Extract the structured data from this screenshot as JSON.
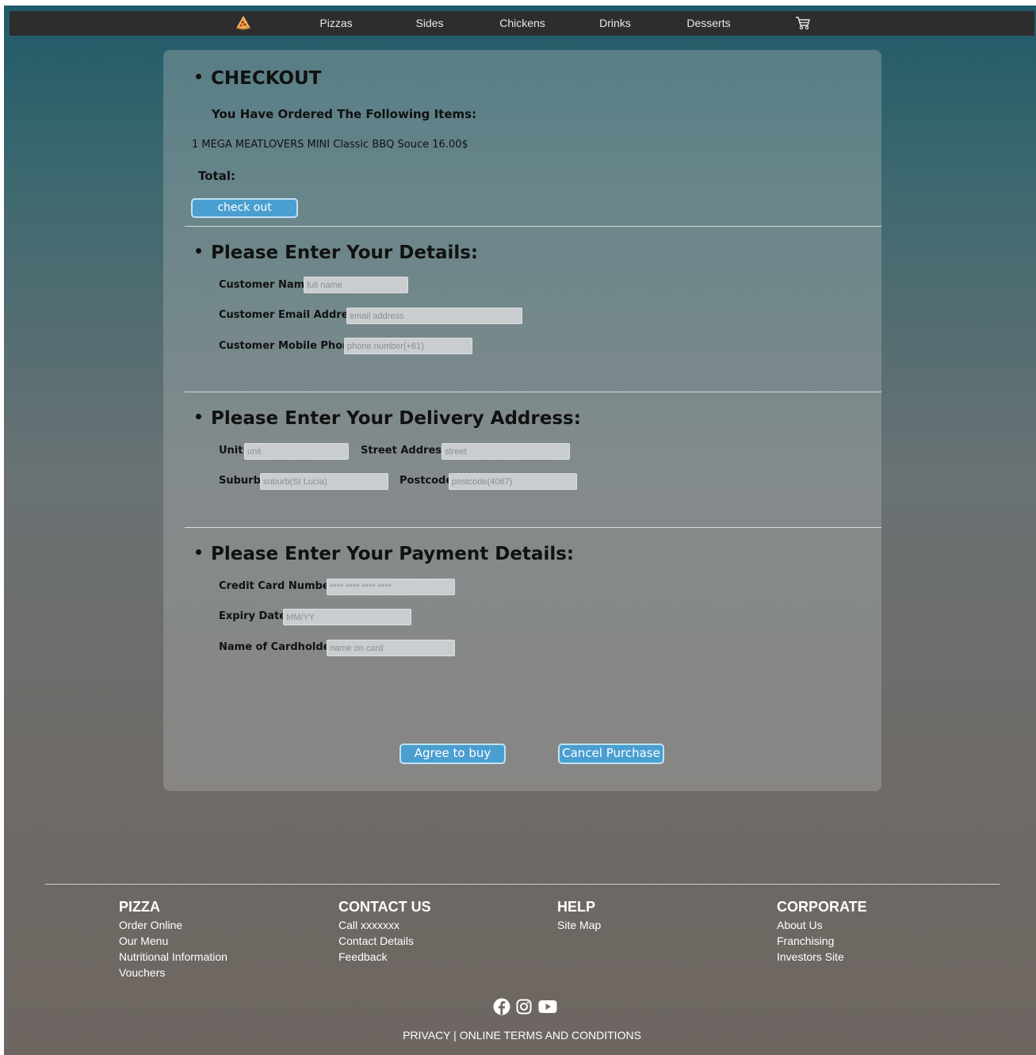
{
  "nav": {
    "items": [
      "Pizzas",
      "Sides",
      "Chickens",
      "Drinks",
      "Desserts"
    ]
  },
  "checkout": {
    "title": "CHECKOUT",
    "ordered_heading": "You Have Ordered The Following Items:",
    "order_line": "1 MEGA MEATLOVERS MINI Classic BBQ Souce 16.00$",
    "total_label": "Total:",
    "checkout_button": "check out"
  },
  "details": {
    "title": "Please Enter Your Details:",
    "name_label": "Customer Name",
    "name_placeholder": "full name",
    "email_label": "Customer Email Address",
    "email_placeholder": "email address",
    "phone_label": "Customer Mobile Phone",
    "phone_placeholder": "phone number(+61)"
  },
  "address": {
    "title": "Please Enter Your Delivery Address:",
    "unit_label": "Unit",
    "unit_placeholder": "unit",
    "street_label": "Street Address",
    "street_placeholder": "street",
    "suburb_label": "Suburb",
    "suburb_placeholder": "suburb(St Lucia)",
    "postcode_label": "Postcode",
    "postcode_placeholder": "postcode(4067)"
  },
  "payment": {
    "title": "Please Enter Your Payment Details:",
    "card_label": "Credit Card Number",
    "card_placeholder": "**** **** **** ****",
    "expiry_label": "Expiry Date",
    "expiry_placeholder": "MM/YY",
    "holder_label": "Name of Cardholder",
    "holder_placeholder": "name on card"
  },
  "actions": {
    "agree": "Agree to buy",
    "cancel": "Cancel Purchase"
  },
  "footer": {
    "columns": [
      {
        "title": "PIZZA",
        "links": [
          "Order Online",
          "Our Menu",
          "Nutritional Information",
          "Vouchers"
        ]
      },
      {
        "title": "CONTACT US",
        "links": [
          "Call xxxxxxx",
          "Contact Details",
          "Feedback"
        ]
      },
      {
        "title": "HELP",
        "links": [
          "Site Map"
        ]
      },
      {
        "title": "CORPORATE",
        "links": [
          "About Us",
          "Franchising",
          "Investors Site"
        ]
      }
    ],
    "privacy": "PRIVACY",
    "separator": " | ",
    "terms": "ONLINE TERMS AND CONDITIONS"
  },
  "icons": {
    "logo": "pizza-slice-icon",
    "cart": "cart-icon",
    "social": [
      "facebook-icon",
      "instagram-icon",
      "youtube-icon"
    ]
  },
  "colors": {
    "nav_bg": "#2d2d2d",
    "button_blue": "#4a9fd0"
  }
}
